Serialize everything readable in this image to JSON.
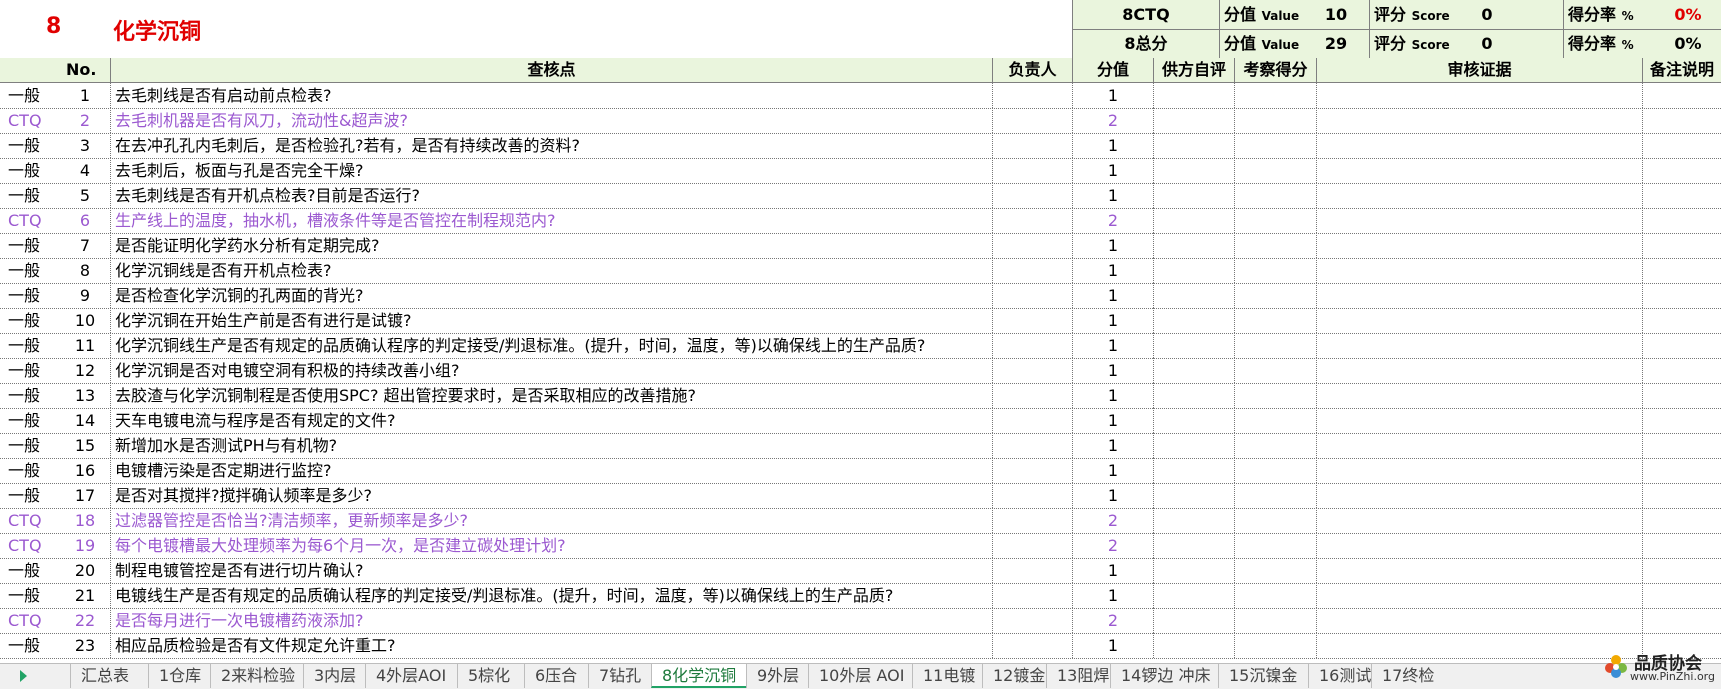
{
  "title": {
    "number": "8",
    "name": "化学沉铜"
  },
  "summary": [
    {
      "label": "8CTQ",
      "value_label": "分值",
      "value_sub": "Value",
      "value": "10",
      "score_label": "评分",
      "score_sub": "Score",
      "score": "0",
      "rate_label": "得分率",
      "rate_sub": "%",
      "rate": "0%",
      "rate_color": "#e00000"
    },
    {
      "label": "8总分",
      "value_label": "分值",
      "value_sub": "Value",
      "value": "29",
      "score_label": "评分",
      "score_sub": "Score",
      "score": "0",
      "rate_label": "得分率",
      "rate_sub": "%",
      "rate": "0%",
      "rate_color": "#000000"
    }
  ],
  "columns": {
    "no": "No.",
    "check": "查核点",
    "owner": "负责人",
    "value": "分值",
    "self_eval": "供方自评",
    "audit_score": "考察得分",
    "evidence": "审核证据",
    "remarks": "备注说明"
  },
  "rows": [
    {
      "type": "一般",
      "no": "1",
      "text": "去毛刺线是否有启动前点检表?",
      "value": "1"
    },
    {
      "type": "CTQ",
      "no": "2",
      "text": "去毛刺机器是否有风刀，流动性&超声波?",
      "value": "2"
    },
    {
      "type": "一般",
      "no": "3",
      "text": "在去冲孔孔内毛刺后，是否检验孔?若有，是否有持续改善的资料?",
      "value": "1"
    },
    {
      "type": "一般",
      "no": "4",
      "text": "去毛刺后，板面与孔是否完全干燥?",
      "value": "1"
    },
    {
      "type": "一般",
      "no": "5",
      "text": "去毛刺线是否有开机点检表?目前是否运行?",
      "value": "1"
    },
    {
      "type": "CTQ",
      "no": "6",
      "text": "生产线上的温度，抽水机，槽液条件等是否管控在制程规范内?",
      "value": "2"
    },
    {
      "type": "一般",
      "no": "7",
      "text": "是否能证明化学药水分析有定期完成?",
      "value": "1"
    },
    {
      "type": "一般",
      "no": "8",
      "text": "化学沉铜线是否有开机点检表?",
      "value": "1"
    },
    {
      "type": "一般",
      "no": "9",
      "text": "是否检查化学沉铜的孔两面的背光?",
      "value": "1"
    },
    {
      "type": "一般",
      "no": "10",
      "text": "化学沉铜在开始生产前是否有进行是试镀?",
      "value": "1"
    },
    {
      "type": "一般",
      "no": "11",
      "text": "化学沉铜线生产是否有规定的品质确认程序的判定接受/判退标准。(提升，时间，温度，等)以确保线上的生产品质?",
      "value": "1"
    },
    {
      "type": "一般",
      "no": "12",
      "text": "化学沉铜是否对电镀空洞有积极的持续改善小组?",
      "value": "1"
    },
    {
      "type": "一般",
      "no": "13",
      "text": "去胶渣与化学沉铜制程是否使用SPC? 超出管控要求时，是否采取相应的改善措施?",
      "value": "1"
    },
    {
      "type": "一般",
      "no": "14",
      "text": "天车电镀电流与程序是否有规定的文件?",
      "value": "1"
    },
    {
      "type": "一般",
      "no": "15",
      "text": "新增加水是否测试PH与有机物?",
      "value": "1"
    },
    {
      "type": "一般",
      "no": "16",
      "text": "电镀槽污染是否定期进行监控?",
      "value": "1"
    },
    {
      "type": "一般",
      "no": "17",
      "text": "是否对其搅拌?搅拌确认频率是多少?",
      "value": "1"
    },
    {
      "type": "CTQ",
      "no": "18",
      "text": "过滤器管控是否恰当?清洁频率，更新频率是多少?",
      "value": "2"
    },
    {
      "type": "CTQ",
      "no": "19",
      "text": "每个电镀槽最大处理频率为每6个月一次，是否建立碳处理计划?",
      "value": "2"
    },
    {
      "type": "一般",
      "no": "20",
      "text": "制程电镀管控是否有进行切片确认?",
      "value": "1"
    },
    {
      "type": "一般",
      "no": "21",
      "text": "电镀线生产是否有规定的品质确认程序的判定接受/判退标准。(提升，时间，温度，等)以确保线上的生产品质?",
      "value": "1"
    },
    {
      "type": "CTQ",
      "no": "22",
      "text": "是否每月进行一次电镀槽药液添加?",
      "value": "2"
    },
    {
      "type": "一般",
      "no": "23",
      "text": "相应品质检验是否有文件规定允许重工?",
      "value": "1"
    }
  ],
  "tabs": [
    "汇总表",
    "1仓库",
    "2来料检验",
    "3内层",
    "4外层AOI",
    "5棕化",
    "6压合",
    "7钻孔",
    "8化学沉铜",
    "9外层",
    "10外层 AOI",
    "11电镀",
    "12镀金",
    "13阻焊",
    "14锣边 冲床",
    "15沉镍金",
    "16测试",
    "17终检"
  ],
  "active_tab": "8化学沉铜",
  "logo": {
    "text": "品质协会",
    "url": "www.PinZhi.org",
    "icon": "flower-logo-icon"
  },
  "colors": {
    "ctq": "#9b59d0",
    "title": "#e00000",
    "header_bg": "#eaf5dd",
    "active_tab": "#21a366"
  }
}
